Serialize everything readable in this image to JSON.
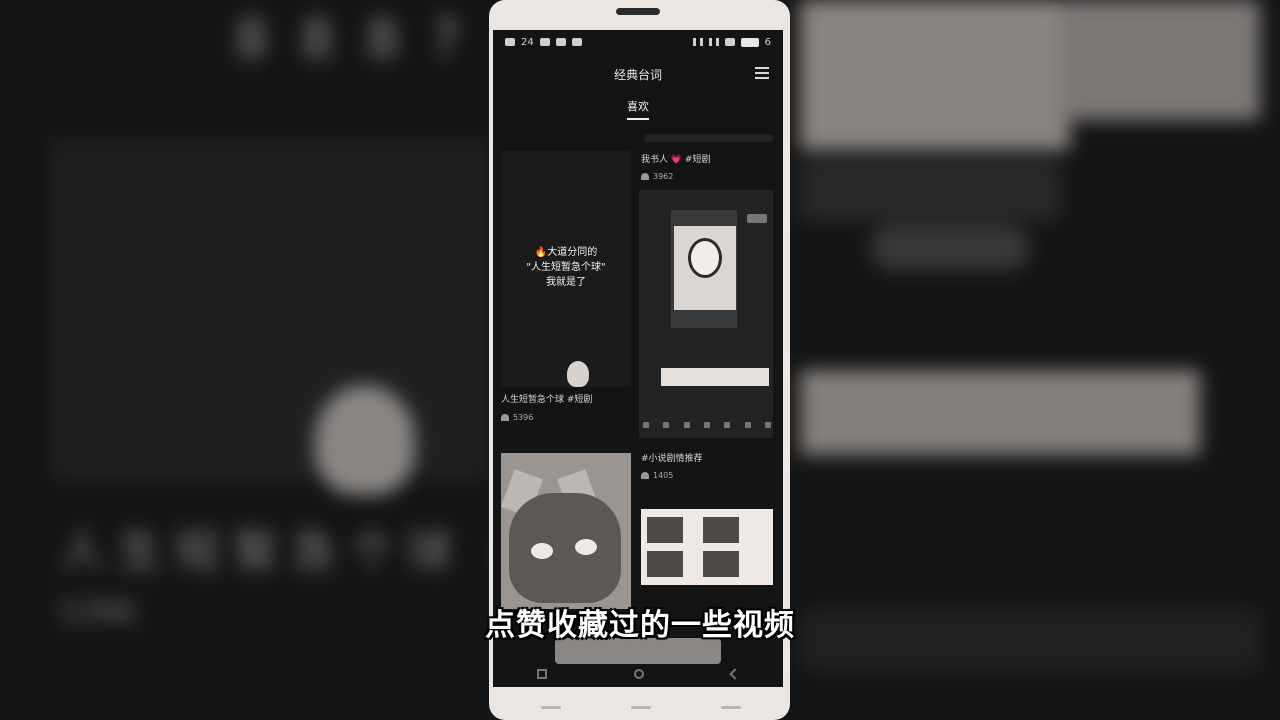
{
  "video": {
    "subtitle": "点赞收藏过的一些视频"
  },
  "status_bar": {
    "left_text": "24",
    "right_text": "6"
  },
  "app": {
    "title": "经典台词",
    "active_tab": "喜欢"
  },
  "feed": {
    "items": [
      {
        "overlay_text": "🔥大道分同的\n\"人生短暂急个球\"\n我就是了",
        "caption": "人生短暂急个球 #短剧",
        "likes": "5396"
      },
      {
        "caption": "我书人 💗 #短剧",
        "likes": "3962"
      },
      {
        "caption": "#小说剧情推荐",
        "likes": "1405"
      }
    ]
  },
  "background": {
    "top_text": "8 8 8 ?",
    "mid_text": "人生短暂急个球 #短剧",
    "meta_text": "5396"
  },
  "colors": {
    "screen_bg": "#141414",
    "phone_body": "#ece6e2",
    "subtitle": "#ffffff"
  }
}
